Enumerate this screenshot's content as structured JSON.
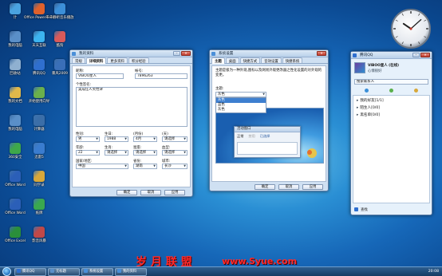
{
  "desktop": {
    "icons": [
      {
        "label": "计",
        "color": "#4aa3e0"
      },
      {
        "label": "Office PowerPoint",
        "color": "#e0612b"
      },
      {
        "label": "千千静听音乐播放",
        "color": "#3c8fd8"
      },
      {
        "label": "我的电脑",
        "color": "#5a8fc8"
      },
      {
        "label": "天天互联",
        "color": "#3cb4f0"
      },
      {
        "label": "酷狗",
        "color": "#d85a5a"
      },
      {
        "label": "回收站",
        "color": "#8fb0d0"
      },
      {
        "label": "腾讯QQ",
        "color": "#2f6fcf"
      },
      {
        "label": "暴风2009",
        "color": "#3a6fb8"
      },
      {
        "label": "我的文档",
        "color": "#e0b84a"
      },
      {
        "label": "开始使用向导",
        "color": "#6ab04c"
      },
      {
        "label": "我的电脑",
        "color": "#5a8fc8"
      },
      {
        "label": "计算器",
        "color": "#3b6ea8"
      },
      {
        "label": "360安全",
        "color": "#3ea84a"
      },
      {
        "label": "迅雷5",
        "color": "#3a7ccf"
      },
      {
        "label": "Office Word",
        "color": "#2b5fb8"
      },
      {
        "label": "同学录",
        "color": "#d8a83a"
      },
      {
        "label": "Office Word",
        "color": "#2b5fb8"
      },
      {
        "label": "纸牌",
        "color": "#3aa84f"
      },
      {
        "label": "Office Excel",
        "color": "#2a8f3a"
      },
      {
        "label": "影音风暴",
        "color": "#c04848"
      }
    ]
  },
  "profile_window": {
    "title": "我的资料",
    "tabs": [
      "常规",
      "详细资料",
      "更多资料",
      "积分经验"
    ],
    "active_tab": 1,
    "nickname_label": "昵称:",
    "nickname_value": "VIBOO星人",
    "account_label": "帐号:",
    "account_value": "7896263",
    "signature_label": "个性签名:",
    "signature_value": "美成任人笑怡津",
    "gender_label": "性别:",
    "gender_value": "男",
    "birthday_label": "生日:",
    "year_value": "1988",
    "month_label": "(月份)",
    "month_value": "4月",
    "day_label": "(天)",
    "day_value": "请选择",
    "age_label": "年龄:",
    "age_value": "22",
    "zodiac_label": "生肖:",
    "zodiac_value": "请选择",
    "star_label": "星座:",
    "star_value": "请选择",
    "blood_label": "血型:",
    "blood_value": "请选择",
    "country_label": "国家/地区:",
    "country_value": "中国",
    "province_label": "省份:",
    "province_value": "湖南",
    "city_label": "城市:",
    "city_value": "长沙",
    "buttons": [
      "确定",
      "取消",
      "应用"
    ]
  },
  "theme_window": {
    "title": "系统设置",
    "tabs": [
      "主题",
      "桌面",
      "快捷方式",
      "音效设置",
      "快捷系统"
    ],
    "active_tab": 0,
    "description": "主题是极为一种外观,图标以及网易外观更改器之性化设置的对外观的变更。",
    "theme_label": "主题:",
    "theme_value": "灰色",
    "theme_options": [
      "灰色",
      "蓝色",
      "灰色"
    ],
    "selected_option": 0,
    "preview_title": "活动窗口",
    "preview_menu": [
      "正常",
      "禁用",
      "已选择"
    ],
    "buttons": [
      "确定",
      "取消",
      "应用"
    ]
  },
  "qq_window": {
    "title": "腾讯QQ",
    "user_name": "VIBOO星人 (在线)",
    "user_status": "心情很好",
    "search_placeholder": "搜索联系人",
    "groups": [
      "我的好友[1/1]",
      "陌生人[0/0]",
      "黑名单[0/0]"
    ],
    "bottom_label": "查找"
  },
  "clock": {
    "hour": 10,
    "minute": 8
  },
  "taskbar": {
    "items": [
      "腾讯QQ",
      "无标题",
      "系统设置",
      "我的资料"
    ],
    "time": "20:08"
  },
  "watermark": {
    "brand": "岁 月 联 盟",
    "url": "www.Syue.com"
  }
}
